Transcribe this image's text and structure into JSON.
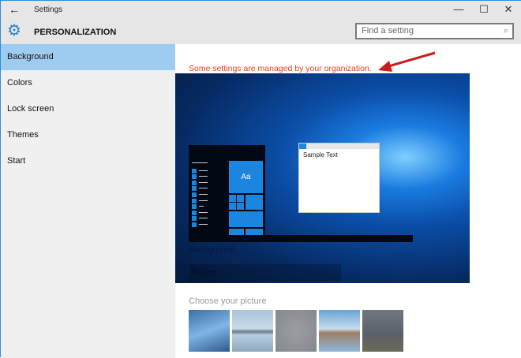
{
  "window": {
    "title": "Settings",
    "back_icon": "←",
    "minimize": "—",
    "maximize": "☐",
    "close": "✕"
  },
  "header": {
    "title": "PERSONALIZATION",
    "search_placeholder": "Find a setting"
  },
  "sidebar": {
    "items": [
      {
        "label": "Background"
      },
      {
        "label": "Colors"
      },
      {
        "label": "Lock screen"
      },
      {
        "label": "Themes"
      },
      {
        "label": "Start"
      }
    ]
  },
  "main": {
    "warning": "Some settings are managed by your organization.",
    "preview": {
      "tile_label": "Aa",
      "window_text": "Sample Text",
      "faded_heading": "Background",
      "faded_dropdown": "Picture"
    },
    "choose_label": "Choose your picture"
  },
  "colors": {
    "accent": "#2b7cd3",
    "warning": "#e8401c",
    "selected": "#9ecbf0"
  }
}
